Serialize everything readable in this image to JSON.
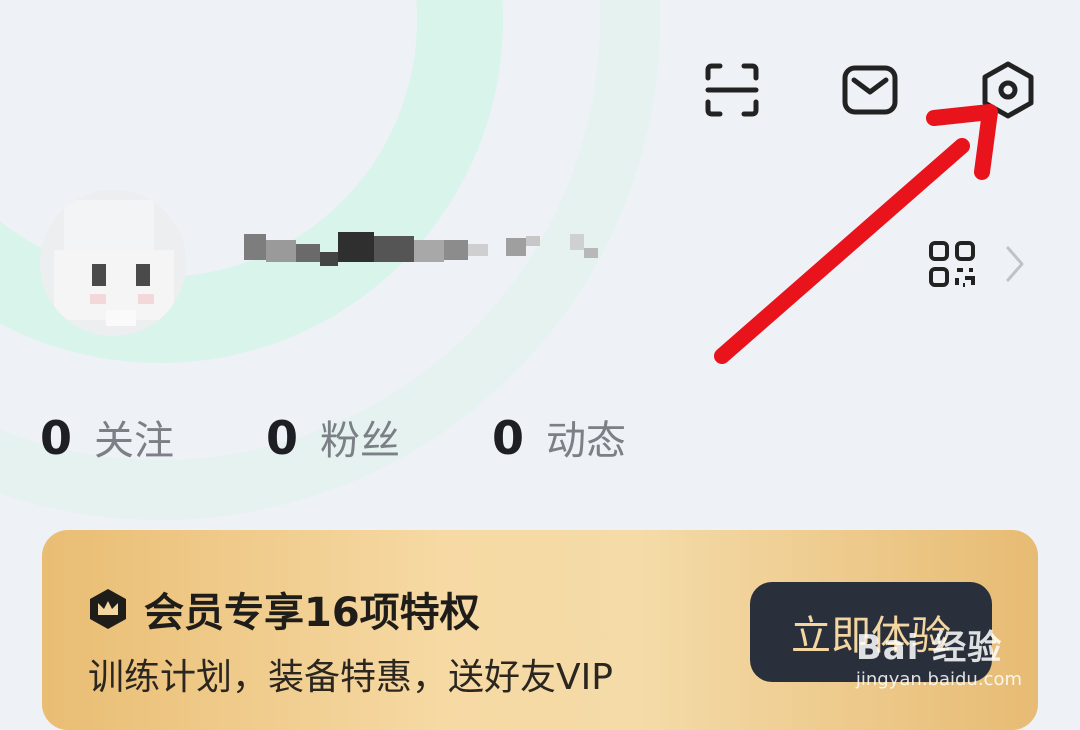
{
  "header": {
    "icons": [
      "scan-icon",
      "mail-icon",
      "settings-icon"
    ]
  },
  "profile": {
    "qr_icon": "qr-code-icon",
    "chevron": "chevron-right-icon"
  },
  "stats": [
    {
      "value": "0",
      "label": "关注"
    },
    {
      "value": "0",
      "label": "粉丝"
    },
    {
      "value": "0",
      "label": "动态"
    }
  ],
  "vip": {
    "title": "会员专享16项特权",
    "subtitle": "训练计划，装备特惠，送好友VIP",
    "button": "立即体验"
  },
  "watermark": {
    "logo": "Bai 经验",
    "url": "jingyan.baidu.com"
  },
  "colors": {
    "background": "#eef1f5",
    "accent_arc": "#d8f3e8",
    "arrow": "#e8131b",
    "vip_gold": "#f4d6a0",
    "vip_button": "#2a2f3c"
  }
}
